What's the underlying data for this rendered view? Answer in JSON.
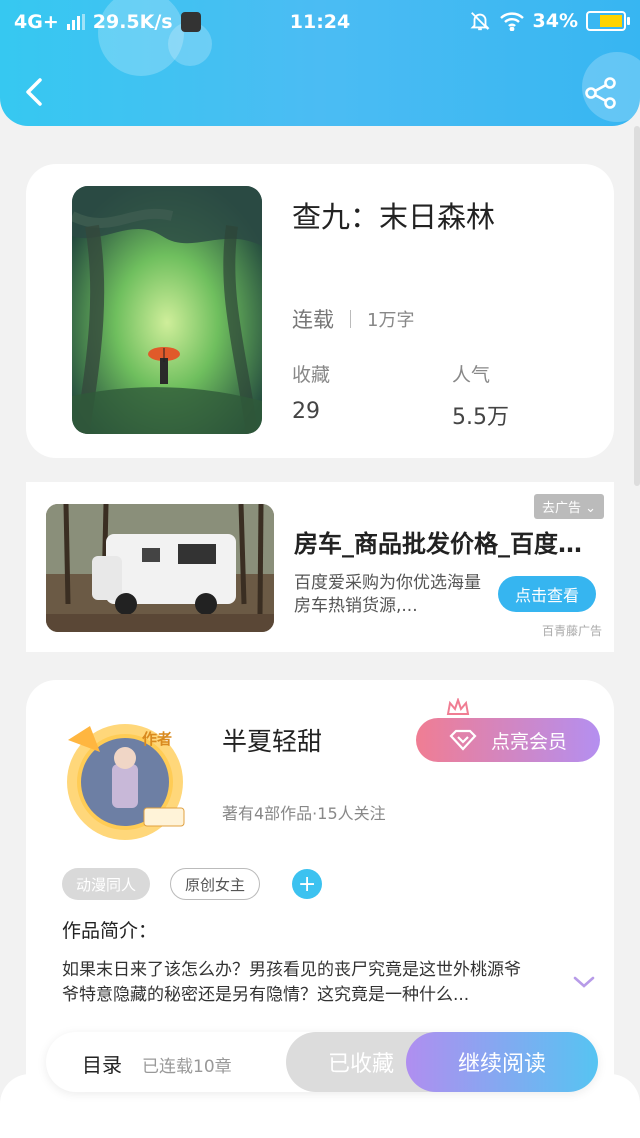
{
  "status_bar": {
    "network": "4G+",
    "speed": "29.5K/s",
    "time": "11:24",
    "battery": "34%"
  },
  "book": {
    "title": "查九：末日森林",
    "status": "连载",
    "word_count": "1万字",
    "favorites_label": "收藏",
    "favorites_value": "29",
    "popularity_label": "人气",
    "popularity_value": "5.5万"
  },
  "ad": {
    "tag": "去广告",
    "title": "房车_商品批发价格_百度...",
    "description": "百度爱采购为你优选海量房车热销货源,...",
    "button": "点击查看",
    "source": "百青藤广告"
  },
  "author": {
    "badge": "作者",
    "name": "半夏轻甜",
    "stats": "著有4部作品·15人关注",
    "vip_button": "点亮会员",
    "tags": [
      "动漫同人",
      "原创女主"
    ],
    "add_tag": "+",
    "intro_label": "作品简介：",
    "intro_text": "如果末日来了该怎么办？男孩看见的丧尸究竟是这世外桃源爷爷特意隐藏的秘密还是另有隐情？这究竟是一种什么..."
  },
  "bottom_bar": {
    "toc_label": "目录",
    "chapters": "已连载10章",
    "collected_button": "已收藏",
    "read_button": "继续阅读"
  },
  "colors": {
    "header": "#36c8f1",
    "accent_blue": "#36b5f0",
    "vip_pink": "#f07d93",
    "vip_purple": "#b48ff0"
  }
}
